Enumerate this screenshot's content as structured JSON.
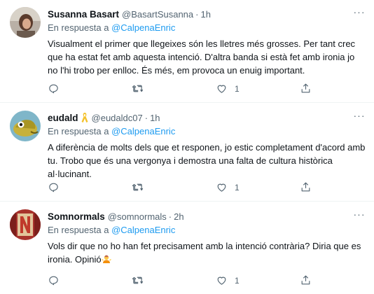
{
  "reply_prefix": "En respuesta a",
  "tweets": [
    {
      "name": "Susanna Basart",
      "handle": "@BasartSusanna",
      "dot": "·",
      "time": "1h",
      "mention": "@CalpenaEnric",
      "text": "Visualment el primer que llegeixes són les lletres més grosses. Per tant crec que ha estat fet amb aquesta intenció. D'altra banda si està fet amb ironia jo no l'hi trobo per enlloc. És més, em provoca un enuig important.",
      "likes": "1"
    },
    {
      "name": "eudald",
      "handle": "@eudaldc07",
      "dot": "·",
      "time": "1h",
      "mention": "@CalpenaEnric",
      "text": "A diferència de molts dels que et responen, jo estic completament d'acord amb tu. Trobo que és una vergonya i demostra una falta de cultura històrica al·lucinant.",
      "likes": "1"
    },
    {
      "name": "Somnormals",
      "handle": "@somnormals",
      "dot": "·",
      "time": "2h",
      "mention": "@CalpenaEnric",
      "text": "Vols dir que no ho han fet precisament amb la intenció contrària? Diria que es ironia. Opinió",
      "likes": "1"
    }
  ],
  "more_label": "···",
  "colors": {
    "accent": "#1d9bf0",
    "muted": "#536471",
    "text": "#0f1419",
    "divider": "#eff3f4"
  },
  "icons": [
    "reply-icon",
    "retweet-icon",
    "like-icon",
    "share-icon",
    "more-icon",
    "yellow-ribbon-icon",
    "shrug-emoji-icon"
  ]
}
